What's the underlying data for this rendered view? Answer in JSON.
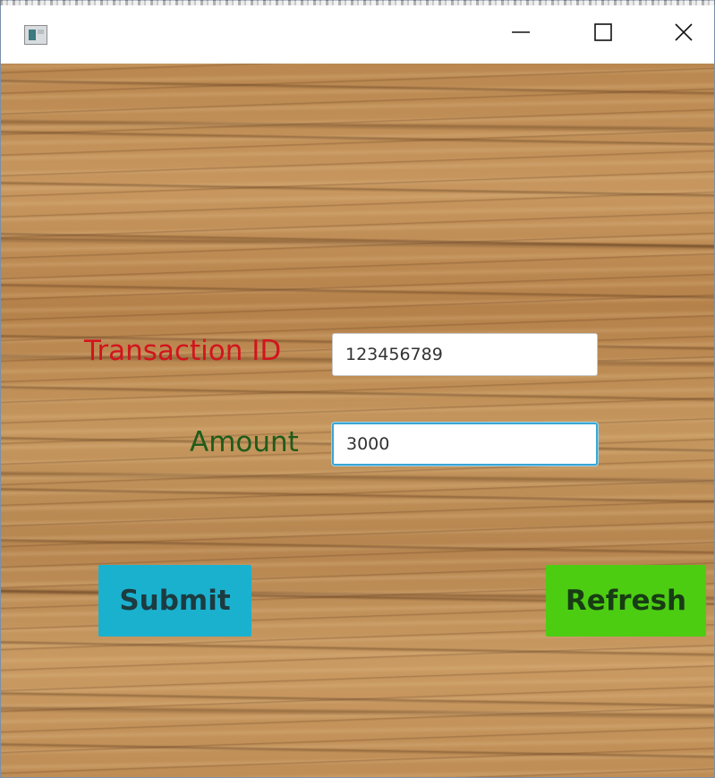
{
  "window": {
    "title": "",
    "controls": {
      "minimize_icon": "minimize-icon",
      "maximize_icon": "maximize-icon",
      "close_icon": "close-icon"
    }
  },
  "form": {
    "transaction_id": {
      "label": "Transaction ID",
      "value": "123456789",
      "label_color": "#d2141d"
    },
    "amount": {
      "label": "Amount",
      "value": "3000",
      "label_color": "#1f5c1a",
      "focused": true
    }
  },
  "buttons": {
    "submit_label": "Submit",
    "submit_color": "#1ab1cf",
    "refresh_label": "Refresh",
    "refresh_color": "#4ccd12"
  }
}
